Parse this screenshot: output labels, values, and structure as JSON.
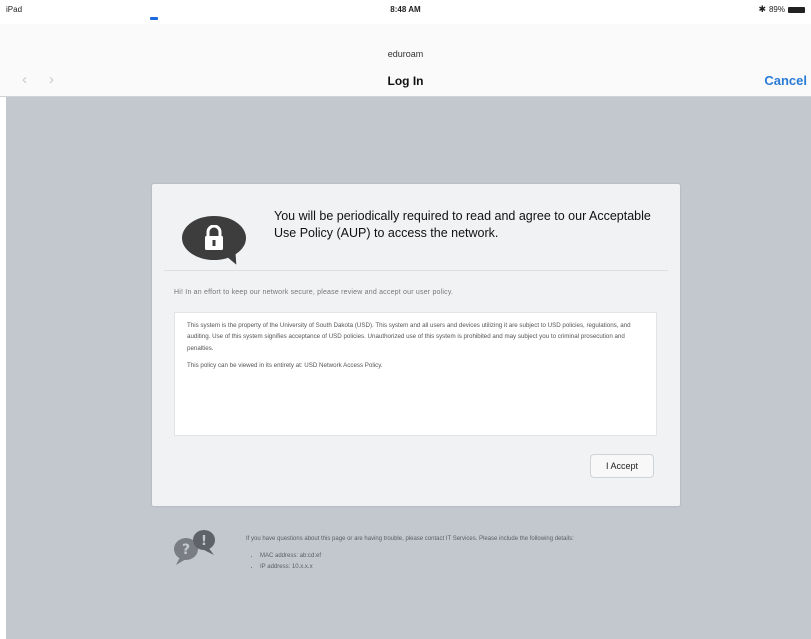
{
  "status_bar": {
    "device": "iPad",
    "time": "8:48 AM",
    "battery": "89%",
    "progress_fraction": 0.1
  },
  "nav": {
    "ssid": "eduroam",
    "title": "Log In",
    "back_glyph": "‹",
    "forward_glyph": "›",
    "cancel_label": "Cancel"
  },
  "card": {
    "icon": "lock-speech-bubble-icon",
    "notice": "You will be periodically required to read and agree to our Acceptable Use Policy (AUP) to access the network.",
    "intro": "Hi! In an effort to keep our network secure, please review and accept our user policy.",
    "policy_paragraphs": [
      "This system is the property of the University of South Dakota (USD). This system and all users and devices utilizing it are subject to USD policies, regulations, and auditing. Use of this system signifies acceptance of USD policies. Unauthorized use of this system is prohibited and may subject you to criminal prosecution and penalties.",
      "This policy can be viewed in its entirety at: USD Network Access Policy."
    ],
    "accept_label": "I Accept"
  },
  "help": {
    "icon": "help-chat-bubbles-icon",
    "text": "If you have questions about this page or are having trouble, please contact IT Services. Please include the following details:",
    "items": [
      "MAC address: ab:cd:ef",
      "IP address: 10.x.x.x"
    ]
  },
  "colors": {
    "accent": "#2a7bd8",
    "background": "#c3c8cf",
    "card": "#f1f2f4"
  }
}
